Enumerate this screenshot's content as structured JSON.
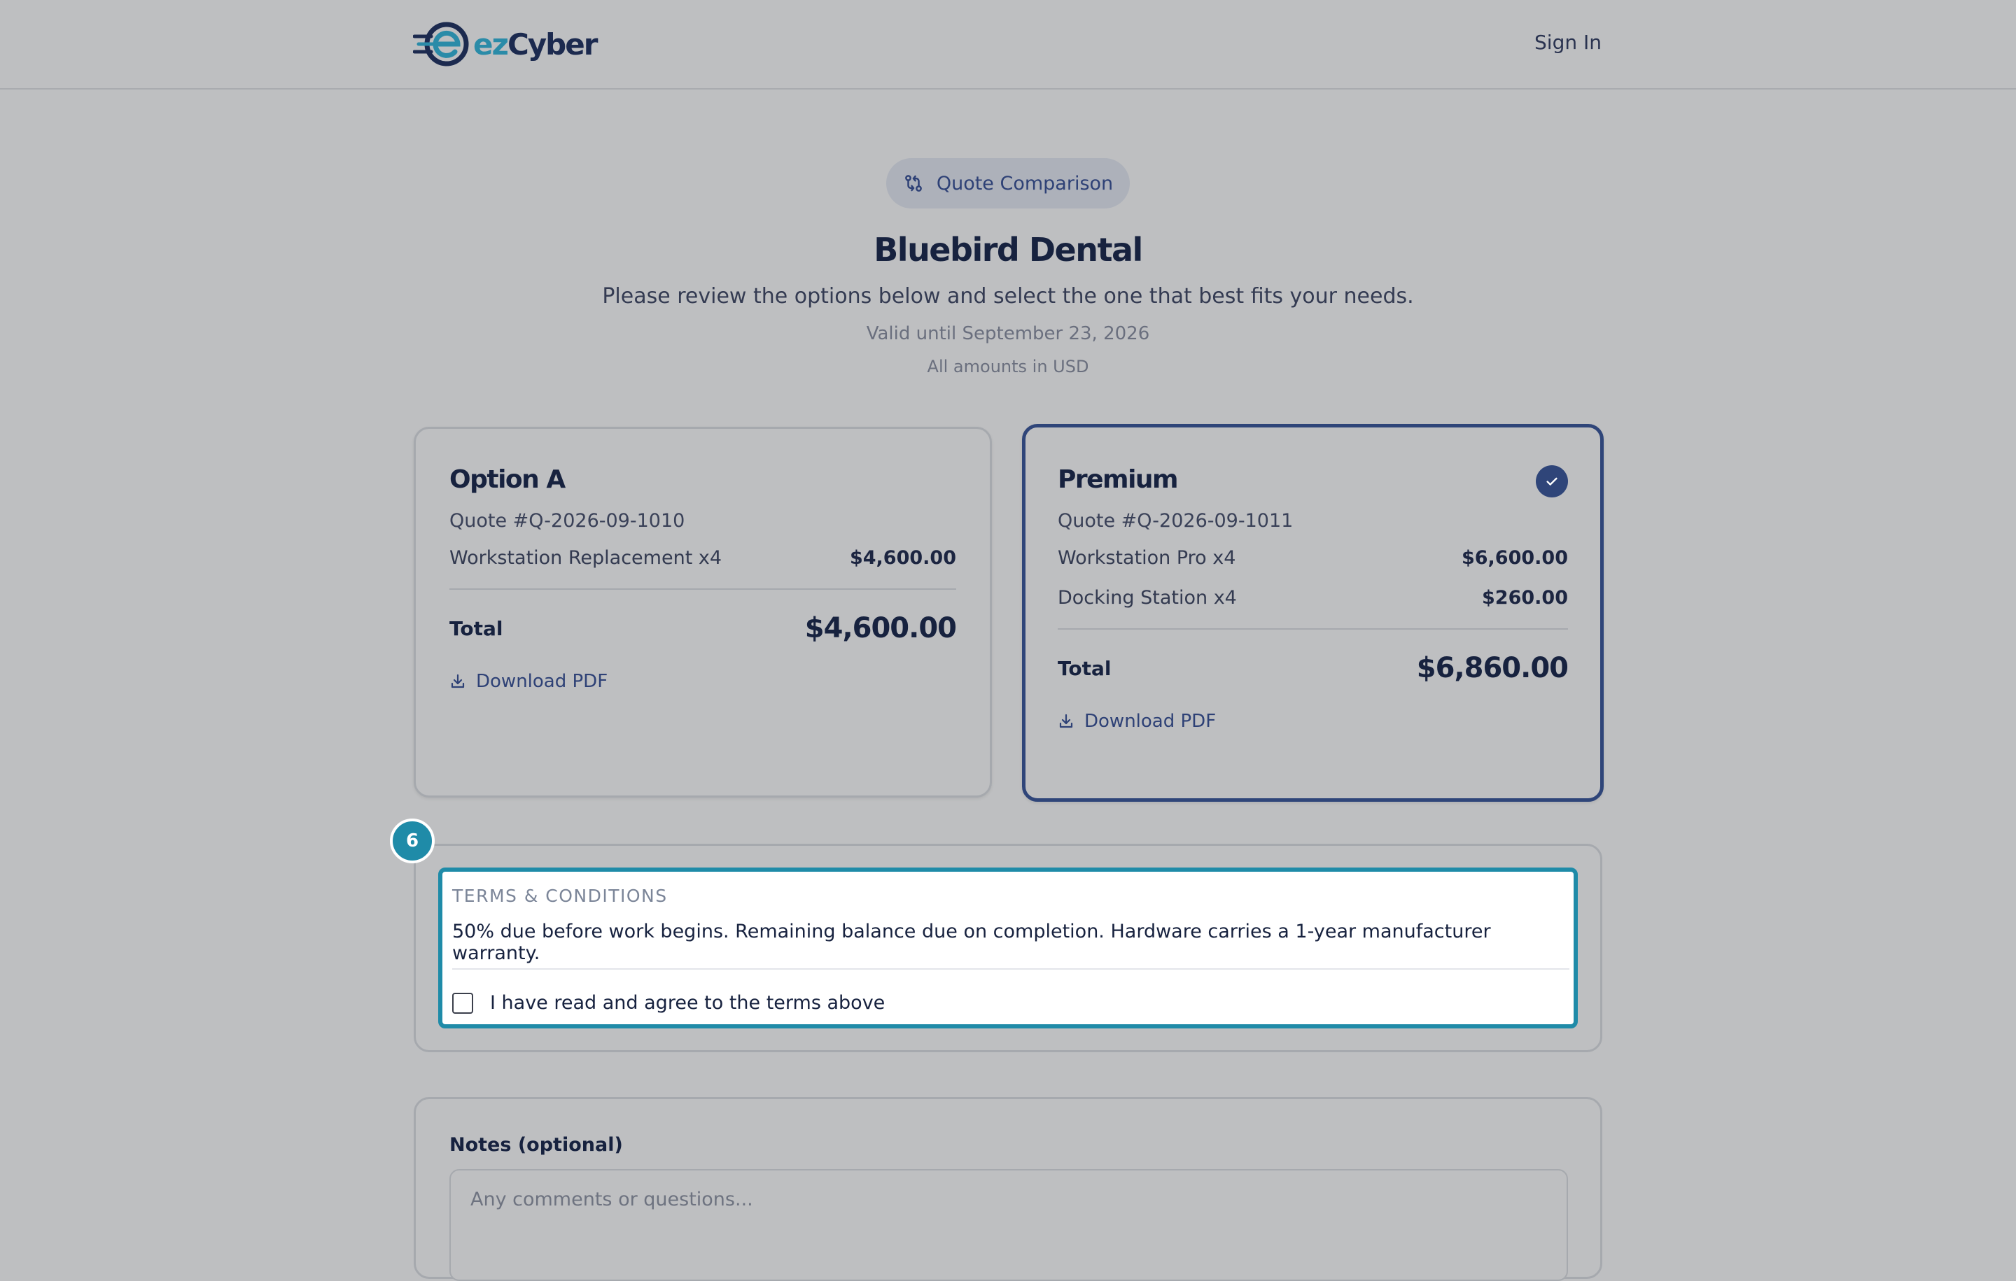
{
  "header": {
    "logo": {
      "ez": "ez",
      "cyber": "Cyber"
    },
    "sign_in": "Sign In"
  },
  "hero": {
    "pill_label": "Quote Comparison",
    "pill_icon": "compare-arrows-icon",
    "title": "Bluebird Dental",
    "subtitle": "Please review the options below and select the one that best fits your needs.",
    "valid_until": "Valid until September 23, 2026",
    "currency_note": "All amounts in USD"
  },
  "options": [
    {
      "title": "Option A",
      "quote_number": "Quote #Q-2026-09-1010",
      "items": [
        {
          "name": "Workstation Replacement x4",
          "amount": "$4,600.00"
        }
      ],
      "total_label": "Total",
      "total": "$4,600.00",
      "download_label": "Download PDF",
      "selected": false
    },
    {
      "title": "Premium",
      "quote_number": "Quote #Q-2026-09-1011",
      "items": [
        {
          "name": "Workstation Pro x4",
          "amount": "$6,600.00"
        },
        {
          "name": "Docking Station x4",
          "amount": "$260.00"
        }
      ],
      "total_label": "Total",
      "total": "$6,860.00",
      "download_label": "Download PDF",
      "selected": true
    }
  ],
  "terms": {
    "step_number": "6",
    "heading": "TERMS & CONDITIONS",
    "text": "50% due before work begins. Remaining balance due on completion. Hardware carries a 1-year manufacturer warranty.",
    "agree_label": "I have read and agree to the terms above",
    "agreed": false
  },
  "notes": {
    "label": "Notes (optional)",
    "placeholder": "Any comments or questions...",
    "value": ""
  },
  "colors": {
    "accent_navy": "#2f4579",
    "accent_teal": "#1f8ba8",
    "overlay_bg": "#bebfc1"
  }
}
